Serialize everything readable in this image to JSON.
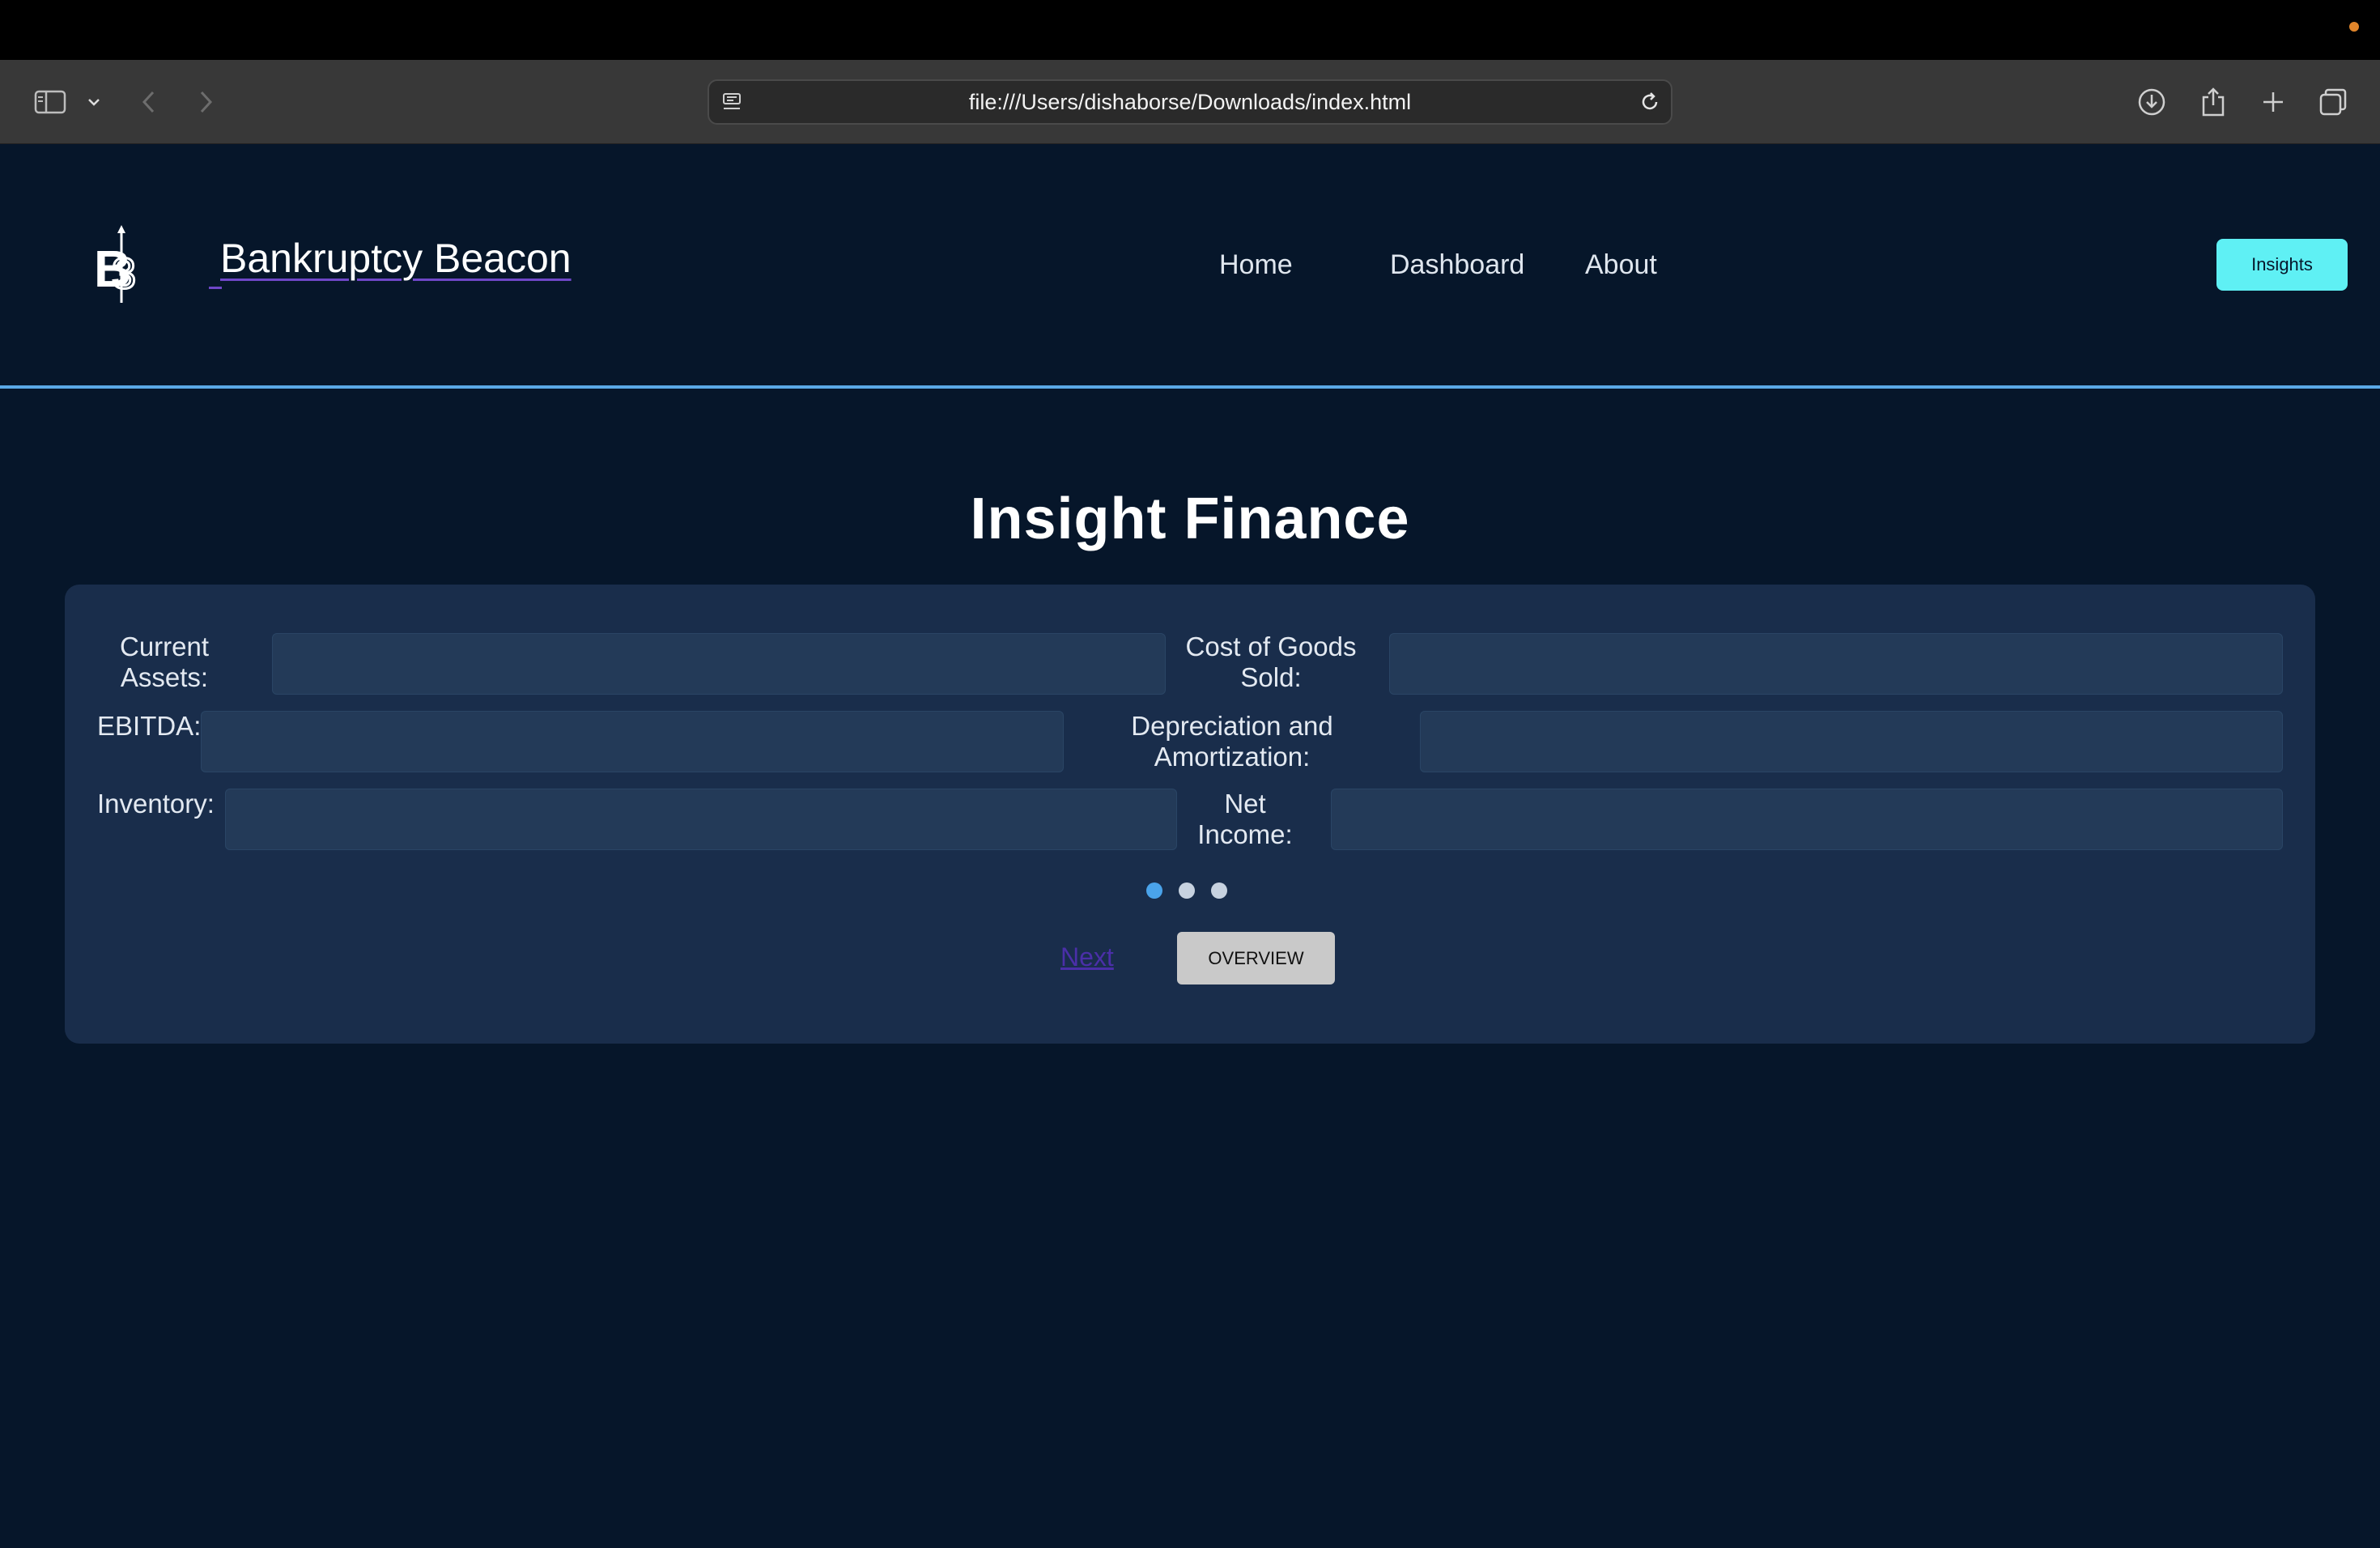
{
  "browser": {
    "url": "file:///Users/dishaborse/Downloads/index.html"
  },
  "header": {
    "brand": "Bankruptcy Beacon",
    "nav": [
      "Home",
      "Dashboard",
      "About"
    ],
    "cta": "Insights"
  },
  "main": {
    "title": "Insight Finance",
    "fields": [
      {
        "label_1": "Current",
        "label_2": "Assets:",
        "value": ""
      },
      {
        "label_1": "Cost of Goods",
        "label_2": "Sold:",
        "value": ""
      },
      {
        "label_1": "EBITDA:",
        "value": ""
      },
      {
        "label_1": "Depreciation and",
        "label_2": "Amortization:",
        "value": ""
      },
      {
        "label_1": "Inventory:",
        "value": ""
      },
      {
        "label_1": "Net",
        "label_2": "Income:",
        "value": ""
      }
    ],
    "pagination": {
      "current": 1,
      "total": 3
    },
    "next_label": "Next",
    "overview_label": "OVERVIEW"
  },
  "colors": {
    "background": "#06162a",
    "card": "#192d4b",
    "accent_cyan": "#5ff0f4",
    "divider_blue": "#5aa8e6",
    "active_dot": "#4aa3ea"
  }
}
